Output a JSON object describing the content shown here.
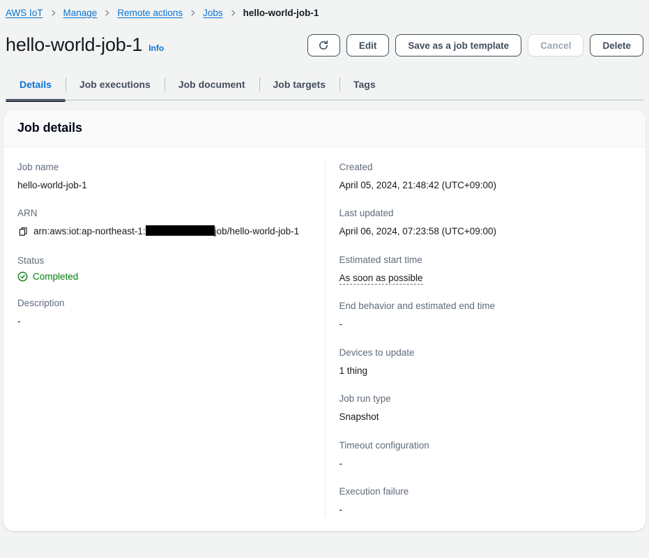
{
  "breadcrumb": {
    "items": [
      {
        "label": "AWS IoT",
        "current": false
      },
      {
        "label": "Manage",
        "current": false
      },
      {
        "label": "Remote actions",
        "current": false
      },
      {
        "label": "Jobs",
        "current": false
      },
      {
        "label": "hello-world-job-1",
        "current": true
      }
    ]
  },
  "header": {
    "title": "hello-world-job-1",
    "info_label": "Info",
    "actions": {
      "refresh_icon": "refresh-icon",
      "edit_label": "Edit",
      "save_template_label": "Save as a job template",
      "cancel_label": "Cancel",
      "cancel_disabled": true,
      "delete_label": "Delete"
    }
  },
  "tabs": [
    {
      "label": "Details",
      "active": true
    },
    {
      "label": "Job executions",
      "active": false
    },
    {
      "label": "Job document",
      "active": false
    },
    {
      "label": "Job targets",
      "active": false
    },
    {
      "label": "Tags",
      "active": false
    }
  ],
  "card": {
    "title": "Job details",
    "left_fields": [
      {
        "label": "Job name",
        "value": "hello-world-job-1"
      },
      {
        "label": "ARN",
        "value_prefix": "arn:aws:iot:ap-northeast-1:",
        "value_suffix": "job/hello-world-job-1",
        "redacted": true,
        "copy_icon": "copy-icon"
      },
      {
        "label": "Status",
        "value": "Completed",
        "status_icon": "status-success-icon",
        "status_color": "#037f0c"
      },
      {
        "label": "Description",
        "value": "-"
      }
    ],
    "right_fields": [
      {
        "label": "Created",
        "value": "April 05, 2024, 21:48:42 (UTC+09:00)"
      },
      {
        "label": "Last updated",
        "value": "April 06, 2024, 07:23:58 (UTC+09:00)"
      },
      {
        "label": "Estimated start time",
        "value": "As soon as possible",
        "dotted": true
      },
      {
        "label": "End behavior and estimated end time",
        "value": "-"
      },
      {
        "label": "Devices to update",
        "value": "1 thing"
      },
      {
        "label": "Job run type",
        "value": "Snapshot"
      },
      {
        "label": "Timeout configuration",
        "value": "-"
      },
      {
        "label": "Execution failure",
        "value": "-"
      }
    ]
  },
  "colors": {
    "link": "#0972d3",
    "background": "#f2f3f3",
    "success": "#037f0c",
    "label": "#5f6b7a",
    "active_tab_underline": "#0f1b2a"
  }
}
